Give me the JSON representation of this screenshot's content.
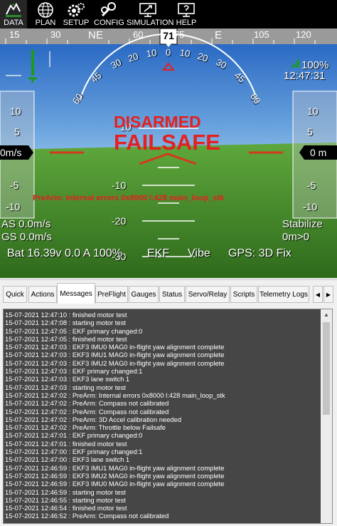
{
  "menu": [
    {
      "label": "DATA",
      "icon": "data-icon"
    },
    {
      "label": "PLAN",
      "icon": "globe-icon"
    },
    {
      "label": "SETUP",
      "icon": "gears-icon"
    },
    {
      "label": "CONFIG",
      "icon": "wrench-icon"
    },
    {
      "label": "SIMULATION",
      "icon": "monitor-plane-icon"
    },
    {
      "label": "HELP",
      "icon": "monitor-help-icon"
    }
  ],
  "hud": {
    "heading_value": "71",
    "heading_ticks": [
      "15",
      "30",
      "NE",
      "60",
      "75",
      "E",
      "105",
      "120"
    ],
    "airspeed": "0m/s",
    "altitude": "0 m",
    "speed_scale": [
      "10",
      "5",
      "-5",
      "-10"
    ],
    "alt_scale": [
      "10",
      "5",
      "-5",
      "-10"
    ],
    "pitch_up": [
      "10"
    ],
    "pitch_down": [
      "-10",
      "-20",
      "-30"
    ],
    "roll_labels": [
      "60",
      "45",
      "30",
      "20",
      "10",
      "0",
      "10",
      "20",
      "30",
      "45",
      "60"
    ],
    "status1": "DISARMED",
    "status2": "FAILSAFE",
    "message": "PreArm: Internal errors 0x8000 l:428 main_loop_stk",
    "battery_percent": "100%",
    "clock": "12:47:31",
    "as": "AS 0.0m/s",
    "gs": "GS 0.0m/s",
    "mode": "Stabilize",
    "wp": "0m>0",
    "bat": "Bat 16.39v 0.0 A 100%",
    "ekf": "EKF",
    "vibe": "Vibe",
    "gps": "GPS: 3D Fix",
    "colors": {
      "sky": "#3a78cc",
      "ground": "#5aa03a",
      "status": "#e61f1f",
      "target": "#d43a1a"
    }
  },
  "tabs": [
    "Quick",
    "Actions",
    "Messages",
    "PreFlight",
    "Gauges",
    "Status",
    "Servo/Relay",
    "Scripts",
    "Telemetry Logs"
  ],
  "active_tab": "Messages",
  "messages": [
    "15-07-2021 12:47:10 : finished motor test",
    "15-07-2021 12:47:08 : starting motor test",
    "15-07-2021 12:47:05 : EKF primary changed:0",
    "15-07-2021 12:47:05 : finished motor test",
    "15-07-2021 12:47:03 : EKF3 IMU0 MAG0 in-flight yaw alignment complete",
    "15-07-2021 12:47:03 : EKF3 IMU1 MAG0 in-flight yaw alignment complete",
    "15-07-2021 12:47:03 : EKF3 IMU2 MAG0 in-flight yaw alignment complete",
    "15-07-2021 12:47:03 : EKF primary changed:1",
    "15-07-2021 12:47:03 : EKF3 lane switch 1",
    "15-07-2021 12:47:03 : starting motor test",
    "15-07-2021 12:47:02 : PreArm: Internal errors 0x8000 l:428 main_loop_stk",
    "15-07-2021 12:47:02 : PreArm: Compass not calibrated",
    "15-07-2021 12:47:02 : PreArm: Compass not calibrated",
    "15-07-2021 12:47:02 : PreArm: 3D Accel calibration needed",
    "15-07-2021 12:47:02 : PreArm: Throttle below Failsafe",
    "15-07-2021 12:47:01 : EKF primary changed:0",
    "15-07-2021 12:47:01 : finished motor test",
    "15-07-2021 12:47:00 : EKF primary changed:1",
    "15-07-2021 12:47:00 : EKF3 lane switch 1",
    "15-07-2021 12:46:59 : EKF3 IMU1 MAG0 in-flight yaw alignment complete",
    "15-07-2021 12:46:59 : EKF3 IMU2 MAG0 in-flight yaw alignment complete",
    "15-07-2021 12:46:59 : EKF3 IMU0 MAG0 in-flight yaw alignment complete",
    "15-07-2021 12:46:59 : starting motor test",
    "15-07-2021 12:46:55 : starting motor test",
    "15-07-2021 12:46:54 : finished motor test",
    "15-07-2021 12:46:52 : PreArm: Compass not calibrated"
  ]
}
